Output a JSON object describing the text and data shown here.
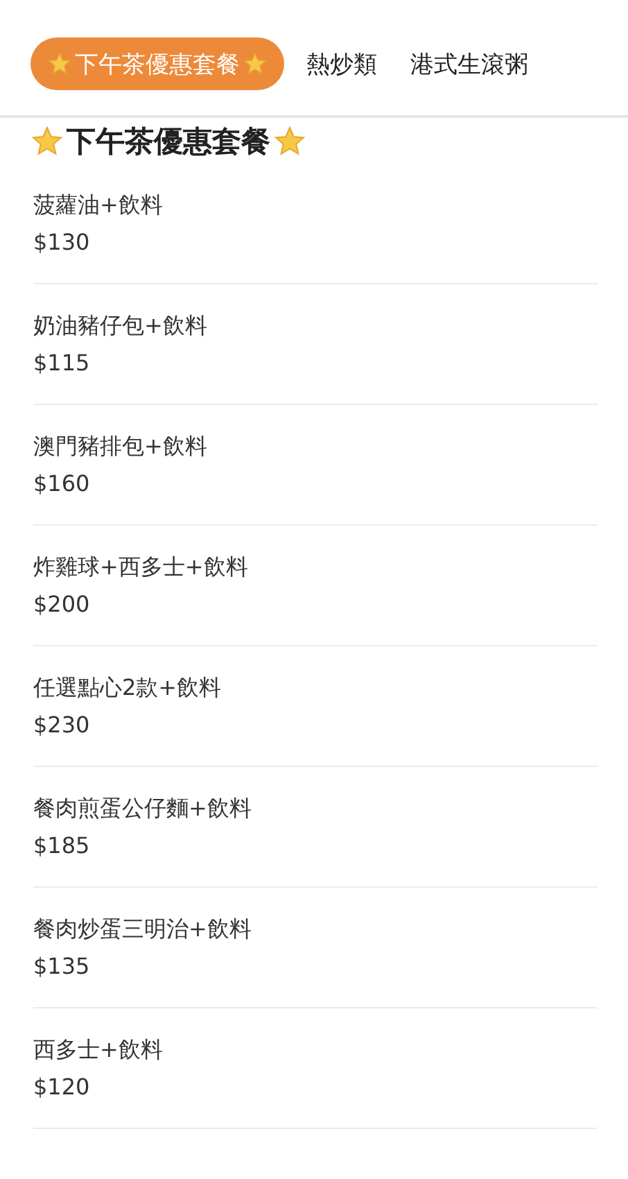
{
  "tabs": [
    {
      "label": "下午茶優惠套餐",
      "selected": true,
      "starred": true
    },
    {
      "label": "熱炒類",
      "selected": false,
      "starred": false
    },
    {
      "label": "港式生滾粥",
      "selected": false,
      "starred": false
    }
  ],
  "section": {
    "title": "下午茶優惠套餐",
    "starred": true
  },
  "items": [
    {
      "name": "菠蘿油+飲料",
      "price": "$130"
    },
    {
      "name": "奶油豬仔包+飲料",
      "price": "$115"
    },
    {
      "name": "澳門豬排包+飲料",
      "price": "$160"
    },
    {
      "name": "炸雞球+西多士+飲料",
      "price": "$200"
    },
    {
      "name": "任選點心2款+飲料",
      "price": "$230"
    },
    {
      "name": "餐肉煎蛋公仔麵+飲料",
      "price": "$185"
    },
    {
      "name": "餐肉炒蛋三明治+飲料",
      "price": "$135"
    },
    {
      "name": "西多士+飲料",
      "price": "$120"
    }
  ]
}
